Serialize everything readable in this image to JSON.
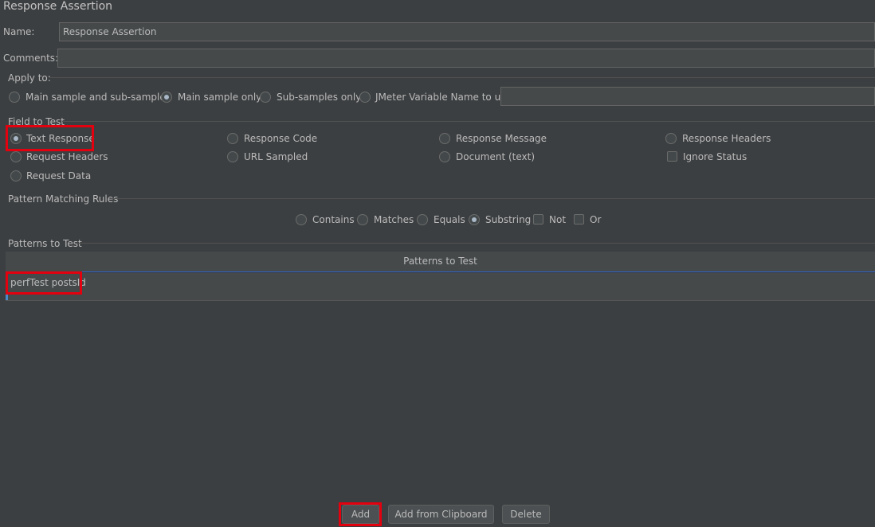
{
  "panel": {
    "title": "Response Assertion",
    "name_label": "Name:",
    "name_value": "Response Assertion",
    "comments_label": "Comments:",
    "comments_value": ""
  },
  "apply_to": {
    "title": "Apply to:",
    "options": [
      "Main sample and sub-samples",
      "Main sample only",
      "Sub-samples only",
      "JMeter Variable Name to use"
    ],
    "selected": "Main sample only",
    "variable_value": ""
  },
  "field_to_test": {
    "title": "Field to Test",
    "options": [
      "Text Response",
      "Response Code",
      "Response Message",
      "Response Headers",
      "Request Headers",
      "URL Sampled",
      "Document (text)",
      "Ignore Status",
      "Request Data"
    ],
    "selected": "Text Response"
  },
  "pattern_matching": {
    "title": "Pattern Matching Rules",
    "options": [
      "Contains",
      "Matches",
      "Equals",
      "Substring",
      "Not",
      "Or"
    ],
    "selected": "Substring"
  },
  "patterns": {
    "title": "Patterns to Test",
    "column_header": "Patterns to Test",
    "rows": [
      "perfTest postsId"
    ]
  },
  "buttons": {
    "add": "Add",
    "add_from_clipboard": "Add from Clipboard",
    "delete": "Delete"
  },
  "colors": {
    "background": "#3c3f41",
    "highlight": "#e3000f",
    "selection_accent": "#4a88c7"
  }
}
